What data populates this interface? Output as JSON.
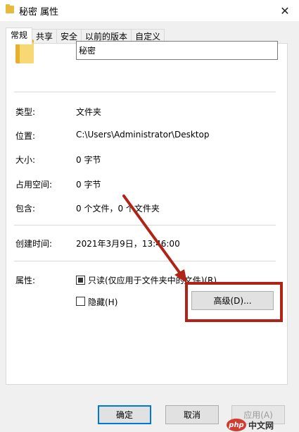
{
  "window": {
    "title": "秘密 属性",
    "close_glyph": "✕"
  },
  "tabs": [
    {
      "label": "常规",
      "active": true
    },
    {
      "label": "共享"
    },
    {
      "label": "安全"
    },
    {
      "label": "以前的版本"
    },
    {
      "label": "自定义"
    }
  ],
  "general": {
    "folder_name": "秘密",
    "type_label": "类型:",
    "type_value": "文件夹",
    "location_label": "位置:",
    "location_value": "C:\\Users\\Administrator\\Desktop",
    "size_label": "大小:",
    "size_value": "0 字节",
    "disk_size_label": "占用空间:",
    "disk_size_value": "0 字节",
    "contains_label": "包含:",
    "contains_value": "0 个文件，0 个文件夹",
    "created_label": "创建时间:",
    "created_value": "2021年3月9日，13:46:00",
    "attributes_label": "属性:",
    "readonly_label": "只读(仅应用于文件夹中的文件)(R)",
    "readonly_checked": true,
    "hidden_label": "隐藏(H)",
    "hidden_checked": false,
    "advanced_button": "高级(D)..."
  },
  "buttons": {
    "ok": "确定",
    "cancel": "取消",
    "apply": "应用(A)"
  },
  "annotation": {
    "color": "#b02418"
  },
  "watermark": {
    "logo": "php",
    "text": "中文网"
  }
}
